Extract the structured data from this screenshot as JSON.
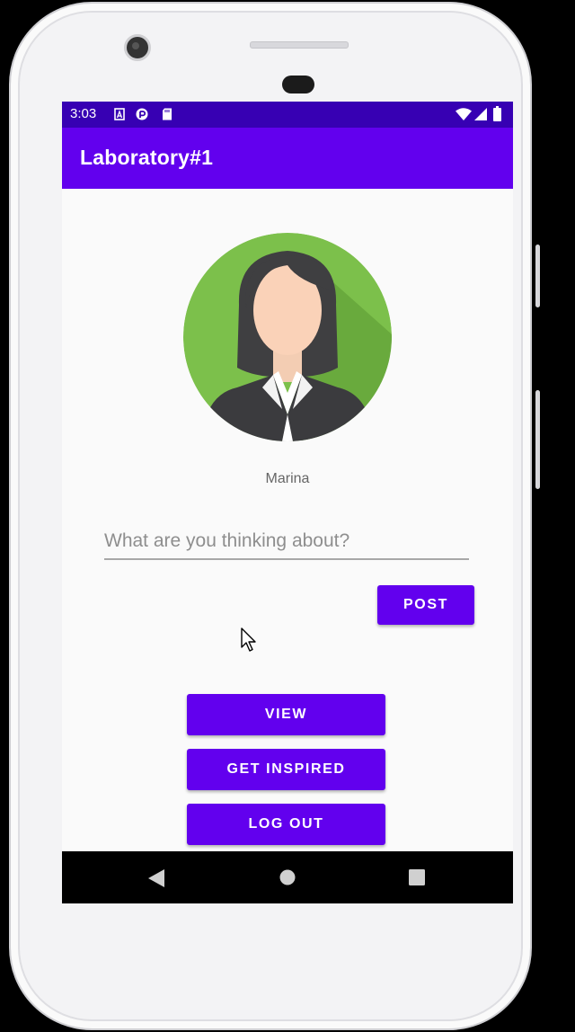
{
  "status_bar": {
    "time": "3:03",
    "left_icons": [
      "a-icon",
      "p-icon",
      "sd-card-icon"
    ],
    "right_icons": [
      "wifi-icon",
      "signal-icon",
      "battery-icon"
    ]
  },
  "app_bar": {
    "title": "Laboratory#1"
  },
  "profile": {
    "name": "Marina"
  },
  "post_input": {
    "placeholder": "What are you thinking about?",
    "value": ""
  },
  "buttons": {
    "post": "POST",
    "view": "VIEW",
    "get_inspired": "GET INSPIRED",
    "log_out": "LOG OUT"
  },
  "nav_bar": {
    "icons": [
      "back-icon",
      "home-icon",
      "recents-icon"
    ]
  },
  "colors": {
    "status_bar": "#3700b3",
    "primary": "#6200ee",
    "avatar_bg": "#7cc04b",
    "background": "#fafafa"
  }
}
